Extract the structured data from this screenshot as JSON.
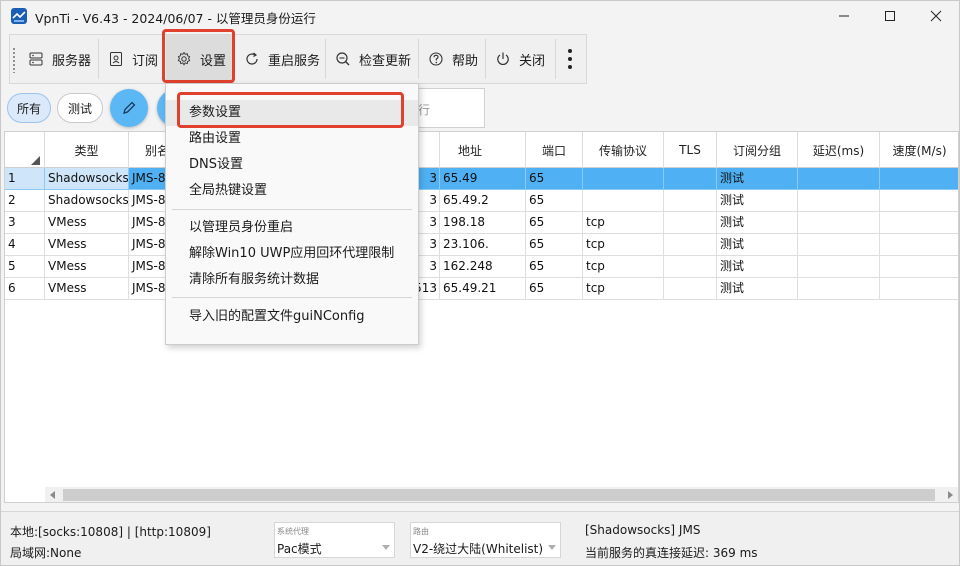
{
  "window": {
    "title": "VpnTi - V6.43 - 2024/06/07 - 以管理员身份运行",
    "icon": "vpn-app-icon"
  },
  "toolbar": {
    "items": [
      {
        "label": "服务器",
        "icon": "server-icon"
      },
      {
        "label": "订阅",
        "icon": "subscription-icon"
      },
      {
        "label": "设置",
        "icon": "gear-icon"
      },
      {
        "label": "重启服务",
        "icon": "restart-icon"
      },
      {
        "label": "检查更新",
        "icon": "update-icon"
      },
      {
        "label": "帮助",
        "icon": "help-icon"
      },
      {
        "label": "关闭",
        "icon": "power-icon"
      }
    ],
    "more_icon": "more-vertical-icon"
  },
  "filters": {
    "all": "所有",
    "test": "测试",
    "search_placeholder": "行"
  },
  "grid": {
    "columns": [
      "类型",
      "别名",
      "",
      "地址",
      "端口",
      "传输协议",
      "TLS",
      "订阅分组",
      "延迟(ms)",
      "速度(M/s)"
    ],
    "rows": [
      {
        "num": "1",
        "type": "Shadowsocks",
        "alias": "JMS-8",
        "partial": "3",
        "addr": "65.49",
        "port": "65",
        "net": "",
        "tls": "",
        "group": "测试",
        "latency": "",
        "speed": ""
      },
      {
        "num": "2",
        "type": "Shadowsocks",
        "alias": "JMS-8",
        "partial": "3",
        "addr": "65.49.2",
        "port": "65",
        "net": "",
        "tls": "",
        "group": "测试",
        "latency": "",
        "speed": ""
      },
      {
        "num": "3",
        "type": "VMess",
        "alias": "JMS-8",
        "partial": "3",
        "addr": "198.18",
        "port": "65",
        "net": "tcp",
        "tls": "",
        "group": "测试",
        "latency": "",
        "speed": ""
      },
      {
        "num": "4",
        "type": "VMess",
        "alias": "JMS-8",
        "partial": "3",
        "addr": "23.106.",
        "port": "65",
        "net": "tcp",
        "tls": "",
        "group": "测试",
        "latency": "",
        "speed": ""
      },
      {
        "num": "5",
        "type": "VMess",
        "alias": "JMS-8",
        "partial": "3",
        "addr": "162.248",
        "port": "65",
        "net": "tcp",
        "tls": "",
        "group": "测试",
        "latency": "",
        "speed": ""
      },
      {
        "num": "6",
        "type": "VMess",
        "alias": "JMS-8",
        "partial": "513",
        "addr": "65.49.21",
        "port": "65",
        "net": "tcp",
        "tls": "",
        "group": "测试",
        "latency": "",
        "speed": ""
      }
    ]
  },
  "settings_menu": {
    "items": [
      "参数设置",
      "路由设置",
      "DNS设置",
      "全局热键设置",
      "以管理员身份重启",
      "解除Win10 UWP应用回环代理限制",
      "清除所有服务统计数据",
      "导入旧的配置文件guiNConfig"
    ]
  },
  "status": {
    "local": "本地:[socks:10808] | [http:10809]",
    "lan": "局域网:None",
    "proxy_caption": "系统代理",
    "proxy_value": "Pac模式",
    "route_caption": "路由",
    "route_value": "V2-绕过大陆(Whitelist)",
    "server": "[Shadowsocks] JMS",
    "latency": "当前服务的真连接延迟: 369 ms"
  },
  "colors": {
    "selected_row": "#4fb1f3",
    "highlight_box": "#e0412e",
    "circle_button": "#5cb8f5"
  }
}
